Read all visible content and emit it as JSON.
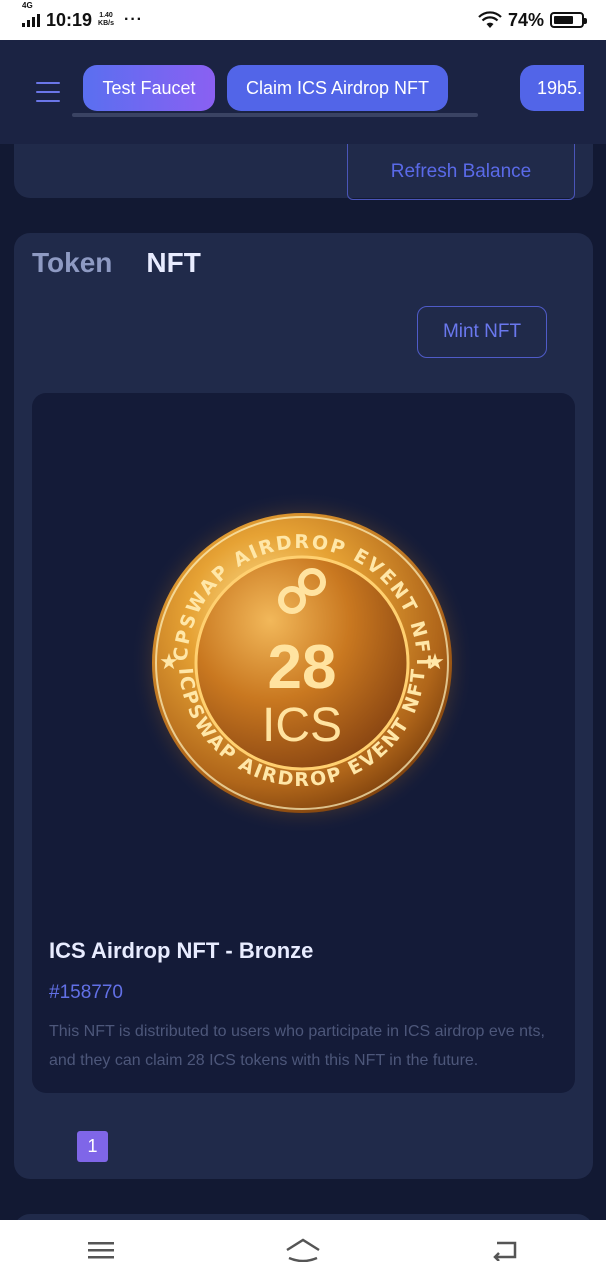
{
  "status_bar": {
    "network": "4G",
    "time": "10:19",
    "speed_value": "1.40",
    "speed_unit": "KB/s",
    "more": "···",
    "battery": "74%",
    "battery_level": 0.74
  },
  "nav": {
    "test_faucet": "Test Faucet",
    "claim_airdrop": "Claim ICS Airdrop NFT",
    "account": "19b5."
  },
  "balance": {
    "refresh_label": "Refresh Balance"
  },
  "tabs": [
    {
      "label": "Token",
      "active": false
    },
    {
      "label": "NFT",
      "active": true
    }
  ],
  "mint_label": "Mint NFT",
  "nft": {
    "coin_top_text": "ICPSWAP AIRDROP EVENT NFT",
    "coin_bottom_text": "ICPSWAP AIRDROP EVENT NFT",
    "coin_amount": "28",
    "coin_unit": "ICS",
    "title": "ICS Airdrop NFT - Bronze",
    "id": "#158770",
    "description": "This NFT is distributed to users who participate in ICS airdrop eve nts, and they can claim 28 ICS tokens with this NFT in the future."
  },
  "pagination": {
    "current": "1"
  },
  "system_nav": {
    "icons": [
      "menu-icon",
      "home-icon",
      "back-icon"
    ]
  }
}
